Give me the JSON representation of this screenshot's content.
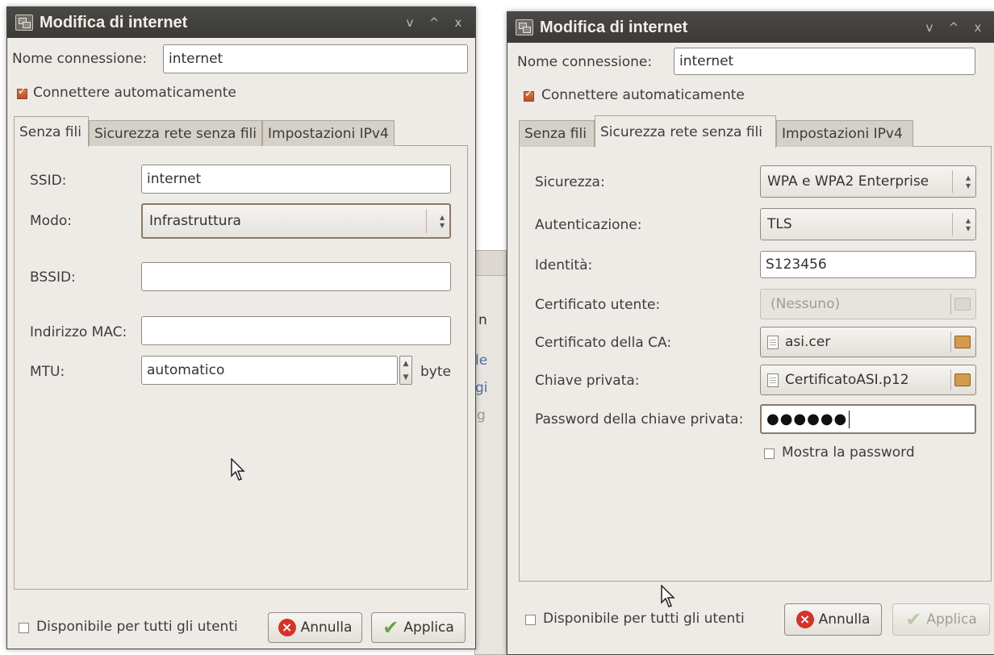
{
  "left": {
    "title": "Modifica di internet",
    "window_buttons": [
      "v",
      "^",
      "x"
    ],
    "connection_name_label": "Nome connessione:",
    "connection_name_value": "internet",
    "auto_connect_label": "Connettere automaticamente",
    "tabs": [
      "Senza fili",
      "Sicurezza rete senza fili",
      "Impostazioni IPv4"
    ],
    "active_tab": "Senza fili",
    "ssid_label": "SSID:",
    "ssid_value": "internet",
    "mode_label": "Modo:",
    "mode_value": "Infrastruttura",
    "bssid_label": "BSSID:",
    "bssid_value": "",
    "mac_label": "Indirizzo MAC:",
    "mac_value": "",
    "mtu_label": "MTU:",
    "mtu_value": "automatico",
    "mtu_unit": "byte",
    "all_users_label": "Disponibile per tutti gli utenti",
    "cancel_label": "Annulla",
    "apply_label": "Applica"
  },
  "background_fragments": [
    "n",
    "le",
    "gi",
    "g"
  ],
  "right": {
    "title": "Modifica di internet",
    "window_buttons": [
      "v",
      "^",
      "x"
    ],
    "connection_name_label": "Nome connessione:",
    "connection_name_value": "internet",
    "auto_connect_label": "Connettere automaticamente",
    "tabs": [
      "Senza fili",
      "Sicurezza rete senza fili",
      "Impostazioni IPv4"
    ],
    "active_tab": "Sicurezza rete senza fili",
    "security_label": "Sicurezza:",
    "security_value": "WPA e WPA2 Enterprise",
    "auth_label": "Autenticazione:",
    "auth_value": "TLS",
    "identity_label": "Identità:",
    "identity_value": "S123456",
    "user_cert_label": "Certificato utente:",
    "user_cert_value": "(Nessuno)",
    "ca_cert_label": "Certificato della CA:",
    "ca_cert_value": "asi.cer",
    "private_key_label": "Chiave privata:",
    "private_key_value": "CertificatoASI.p12",
    "pk_password_label": "Password della chiave privata:",
    "pk_password_value": "●●●●●●",
    "show_password_label": "Mostra la password",
    "all_users_label": "Disponibile per tutti gli utenti",
    "cancel_label": "Annulla",
    "apply_label": "Applica"
  },
  "colors": {
    "titlebar": "#3b3a36",
    "dialog_bg": "#eeebe7",
    "checkbox_checked": "#c45f35",
    "cancel_icon": "#d3332b",
    "apply_icon": "#6ca43a"
  }
}
